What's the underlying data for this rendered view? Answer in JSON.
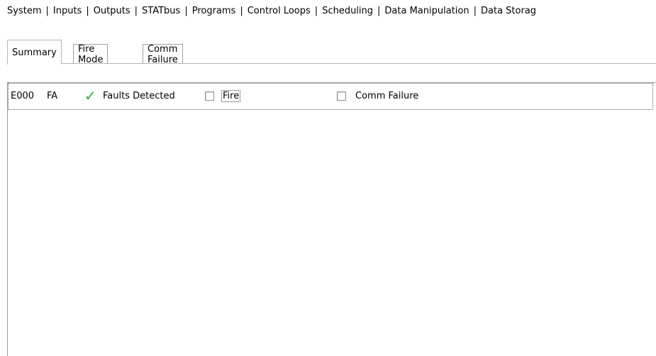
{
  "top_tabs": [
    {
      "label": "System"
    },
    {
      "label": "Inputs"
    },
    {
      "label": "Outputs"
    },
    {
      "label": "STATbus"
    },
    {
      "label": "Programs"
    },
    {
      "label": "Control Loops"
    },
    {
      "label": "Scheduling"
    },
    {
      "label": "Data Manipulation"
    },
    {
      "label": "Data Storag"
    }
  ],
  "inner_tabs": [
    {
      "label": "Summary",
      "active": true
    },
    {
      "label": "Fire Mode",
      "active": false
    },
    {
      "label": "Comm Failure",
      "active": false
    }
  ],
  "row": {
    "id": "E000",
    "code": "FA",
    "faults_detected_label": "Faults Detected",
    "faults_detected_checked": true,
    "fire_label": "Fire",
    "fire_checked": false,
    "comm_failure_label": "Comm Failure",
    "comm_failure_checked": false
  },
  "colors": {
    "check_green": "#21b52c",
    "border": "#a0a0a0"
  },
  "icons": {
    "faults_detected": "green-check-icon"
  }
}
